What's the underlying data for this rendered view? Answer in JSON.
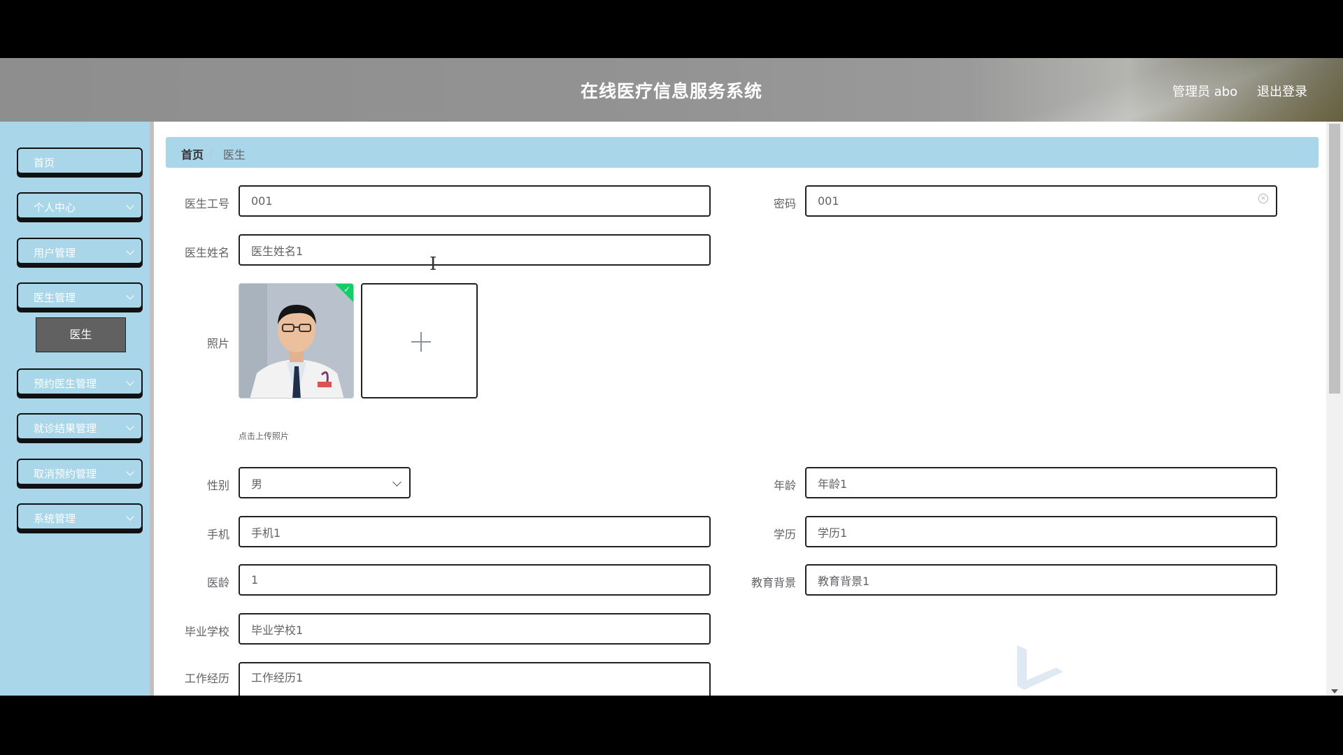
{
  "header": {
    "title": "在线医疗信息服务系统",
    "user_label": "管理员 abo",
    "logout_label": "退出登录"
  },
  "sidebar": {
    "items": [
      {
        "label": "首页"
      },
      {
        "label": "个人中心"
      },
      {
        "label": "用户管理"
      },
      {
        "label": "医生管理"
      },
      {
        "label": "预约医生管理"
      },
      {
        "label": "就诊结果管理"
      },
      {
        "label": "取消预约管理"
      },
      {
        "label": "系统管理"
      }
    ],
    "submenu": {
      "label": "医生"
    }
  },
  "breadcrumb": {
    "home": "首页",
    "separator": "/",
    "current": "医生"
  },
  "form": {
    "doctor_id": {
      "label": "医生工号",
      "value": "001"
    },
    "password": {
      "label": "密码",
      "value": "001"
    },
    "doctor_name": {
      "label": "医生姓名",
      "value": "医生姓名1"
    },
    "photo": {
      "label": "照片",
      "tip": "点击上传照片"
    },
    "gender": {
      "label": "性别",
      "value": "男"
    },
    "age": {
      "label": "年龄",
      "value": "年龄1"
    },
    "phone": {
      "label": "手机",
      "value": "手机1"
    },
    "education": {
      "label": "学历",
      "value": "学历1"
    },
    "years_practice": {
      "label": "医龄",
      "value": "1"
    },
    "edu_background": {
      "label": "教育背景",
      "value": "教育背景1"
    },
    "school": {
      "label": "毕业学校",
      "value": "毕业学校1"
    },
    "experience": {
      "label": "工作经历",
      "value": "工作经历1"
    }
  },
  "colors": {
    "sidebar_bg": "#a9d6e8",
    "breadcrumb_bg": "#a9d6e8",
    "submenu_bg": "#616161",
    "success": "#13ce66"
  },
  "icons": [
    "chevron-down-icon",
    "clear-icon",
    "plus-icon",
    "check-icon",
    "select-arrow-icon"
  ]
}
